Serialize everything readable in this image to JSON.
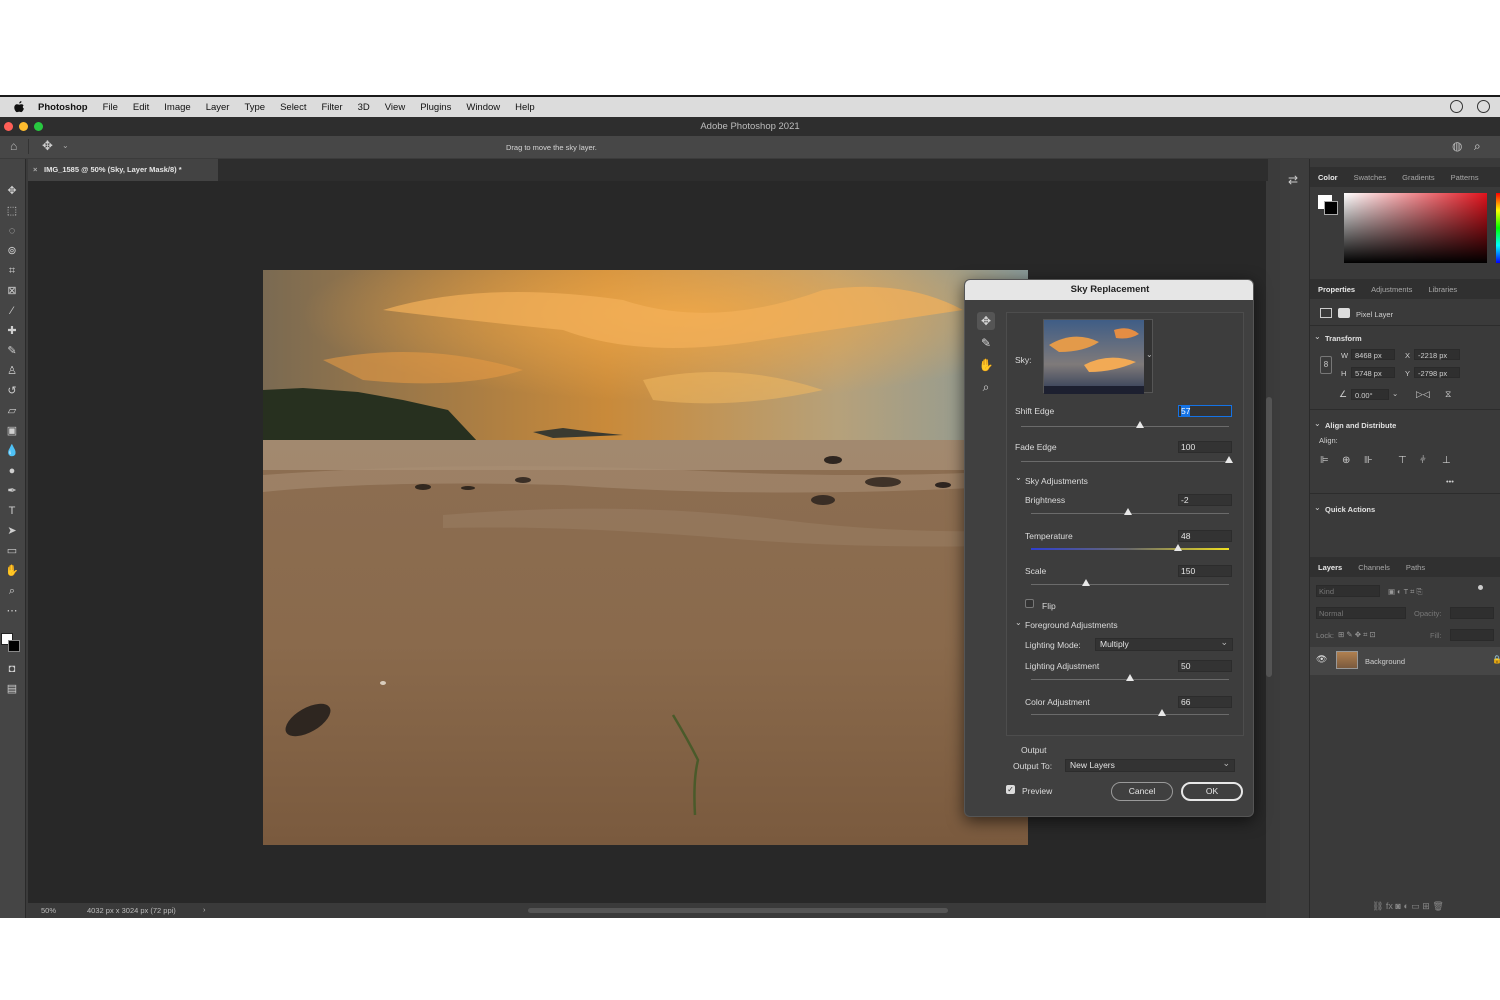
{
  "menubar": {
    "app_name": "Photoshop",
    "items": [
      "File",
      "Edit",
      "Image",
      "Layer",
      "Type",
      "Select",
      "Filter",
      "3D",
      "View",
      "Plugins",
      "Window",
      "Help"
    ]
  },
  "window": {
    "title": "Adobe Photoshop 2021"
  },
  "options_bar": {
    "hint": "Drag to move the sky layer."
  },
  "document": {
    "tab_label": "IMG_1585 @ 50% (Sky, Layer Mask/8) *"
  },
  "status_bar": {
    "zoom": "50%",
    "doc_info": "4032 px x 3024 px (72 ppi)"
  },
  "color_panel": {
    "tabs": [
      "Color",
      "Swatches",
      "Gradients",
      "Patterns"
    ]
  },
  "properties_panel": {
    "tabs": [
      "Properties",
      "Adjustments",
      "Libraries"
    ],
    "layer_type": "Pixel Layer",
    "transform_label": "Transform",
    "w_label": "W",
    "w_value": "8468 px",
    "h_label": "H",
    "h_value": "5748 px",
    "x_label": "X",
    "x_value": "-2218 px",
    "y_label": "Y",
    "y_value": "-2798 px",
    "angle_value": "0.00°",
    "align_label": "Align and Distribute",
    "align_sub": "Align:",
    "quick_actions": "Quick Actions",
    "more": "•••"
  },
  "layers_panel": {
    "tabs": [
      "Layers",
      "Channels",
      "Paths"
    ],
    "search_placeholder": "Kind",
    "blend_mode": "Normal",
    "opacity_label": "Opacity:",
    "lock_label": "Lock:",
    "fill_label": "Fill:",
    "layers": [
      {
        "name": "Background"
      }
    ]
  },
  "sky_dialog": {
    "title": "Sky Replacement",
    "sky_label": "Sky:",
    "shift_edge": {
      "label": "Shift Edge",
      "value": "57",
      "level": 0.57
    },
    "fade_edge": {
      "label": "Fade Edge",
      "value": "100",
      "level": 1.0
    },
    "sky_adjustments_label": "Sky Adjustments",
    "brightness": {
      "label": "Brightness",
      "value": "-2",
      "level": 0.49
    },
    "temperature": {
      "label": "Temperature",
      "value": "48",
      "level": 0.74
    },
    "scale": {
      "label": "Scale",
      "value": "150",
      "level": 0.28
    },
    "flip_label": "Flip",
    "foreground_label": "Foreground Adjustments",
    "lighting_mode_label": "Lighting Mode:",
    "lighting_mode_value": "Multiply",
    "lighting_adjustment": {
      "label": "Lighting Adjustment",
      "value": "50",
      "level": 0.5
    },
    "color_adjustment": {
      "label": "Color Adjustment",
      "value": "66",
      "level": 0.66
    },
    "output_label": "Output",
    "output_to_label": "Output To:",
    "output_to_value": "New Layers",
    "preview_label": "Preview",
    "cancel_label": "Cancel",
    "ok_label": "OK"
  },
  "colors": {
    "accent": "#1473e6",
    "panel_bg": "#3a3a3a",
    "canvas_bg": "#282828"
  }
}
